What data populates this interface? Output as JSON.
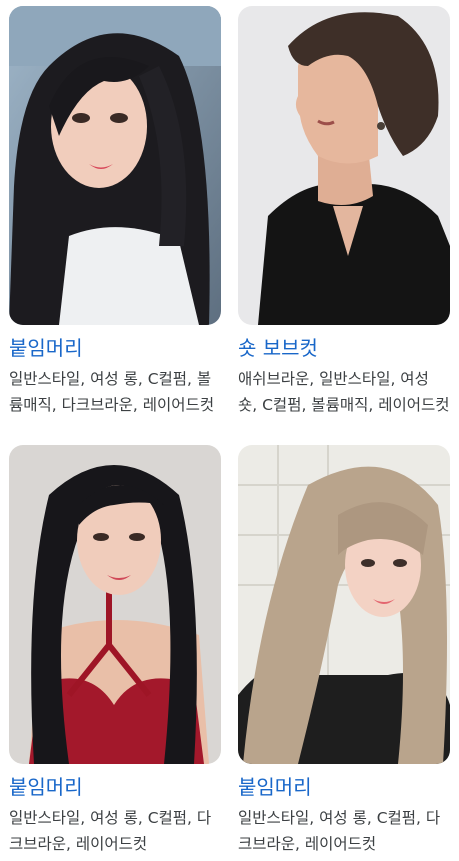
{
  "cards": [
    {
      "title": "붙임머리",
      "description": "일반스타일, 여성 롱, C컬펌, 볼륨매직, 다크브라운, 레이어드컷",
      "image_alt": "long dark hair selfie"
    },
    {
      "title": "숏 보브컷",
      "description": "애쉬브라운, 일반스타일, 여성 숏, C컬펌, 볼륨매직, 레이어드컷",
      "image_alt": "short bob haircut profile"
    },
    {
      "title": "붙임머리",
      "description": "일반스타일, 여성 롱, C컬펌, 다크브라운, 레이어드컷",
      "image_alt": "long black wavy hair"
    },
    {
      "title": "붙임머리",
      "description": "일반스타일, 여성 롱, C컬펌, 다크브라운, 레이어드컷",
      "image_alt": "long ash blonde wavy hair with bangs"
    }
  ]
}
